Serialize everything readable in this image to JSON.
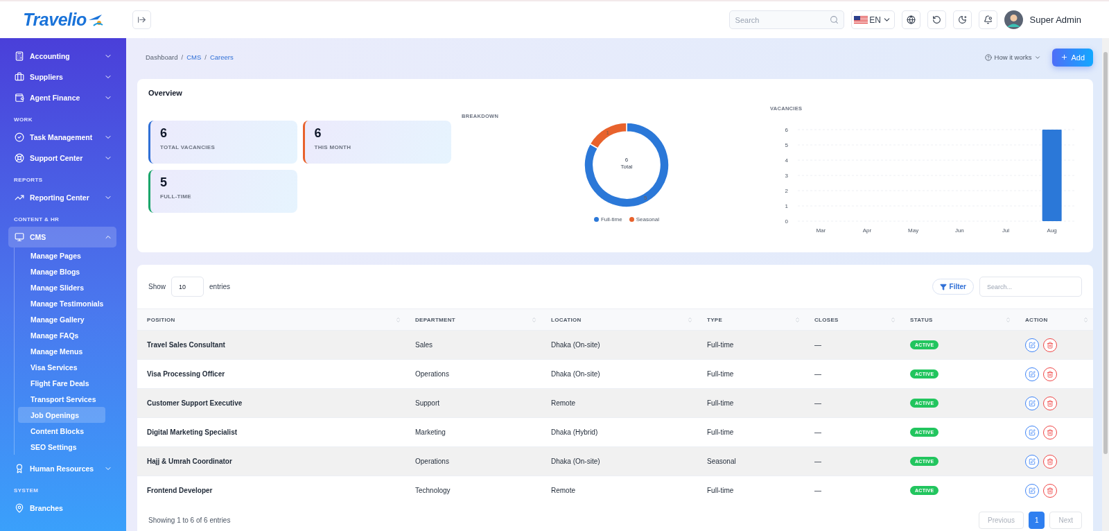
{
  "brand": {
    "name": "Travelio"
  },
  "header": {
    "search": {
      "placeholder": "Search"
    },
    "language": "EN",
    "user": "Super Admin"
  },
  "sidebar": {
    "sections": [
      {
        "items": [
          {
            "label": "Accounting",
            "expanded": false
          },
          {
            "label": "Suppliers",
            "expanded": false
          },
          {
            "label": "Agent Finance",
            "expanded": false
          }
        ]
      },
      {
        "title": "WORK",
        "items": [
          {
            "label": "Task Management",
            "expanded": false
          },
          {
            "label": "Support Center",
            "expanded": false
          }
        ]
      },
      {
        "title": "REPORTS",
        "items": [
          {
            "label": "Reporting Center",
            "expanded": false
          }
        ]
      },
      {
        "title": "CONTENT & HR",
        "items": [
          {
            "label": "CMS",
            "expanded": true,
            "children": [
              {
                "label": "Manage Pages",
                "selected": false
              },
              {
                "label": "Manage Blogs",
                "selected": false
              },
              {
                "label": "Manage Sliders",
                "selected": false
              },
              {
                "label": "Manage Testimonials",
                "selected": false
              },
              {
                "label": "Manage Gallery",
                "selected": false
              },
              {
                "label": "Manage FAQs",
                "selected": false
              },
              {
                "label": "Manage Menus",
                "selected": false
              },
              {
                "label": "Visa Services",
                "selected": false
              },
              {
                "label": "Flight Fare Deals",
                "selected": false
              },
              {
                "label": "Transport Services",
                "selected": false
              },
              {
                "label": "Job Openings",
                "selected": true
              },
              {
                "label": "Content Blocks",
                "selected": false
              },
              {
                "label": "SEO Settings",
                "selected": false
              }
            ]
          },
          {
            "label": "Human Resources",
            "expanded": false
          }
        ]
      },
      {
        "title": "SYSTEM",
        "items": [
          {
            "label": "Branches"
          }
        ]
      }
    ]
  },
  "breadcrumbs": {
    "separator": "/",
    "items": [
      {
        "label": "Dashboard",
        "link": false
      },
      {
        "label": "CMS",
        "link": true
      },
      {
        "label": "Careers",
        "link": true
      }
    ]
  },
  "page_actions": {
    "help": "How it works",
    "add": "Add"
  },
  "overview": {
    "title": "Overview",
    "stats": [
      {
        "value": "6",
        "label": "TOTAL VACANCIES",
        "color": "#2f6fd6"
      },
      {
        "value": "6",
        "label": "THIS MONTH",
        "color": "#e8622c"
      },
      {
        "value": "5",
        "label": "FULL-TIME",
        "color": "#1aa56a"
      }
    ],
    "breakdown": {
      "title": "BREAKDOWN",
      "center_value": "6",
      "center_label": "Total",
      "chart_data": {
        "type": "donut",
        "categories": [
          "Full-time",
          "Seasonal"
        ],
        "values": [
          5,
          1
        ],
        "colors": [
          "#2b78d8",
          "#e8622c"
        ],
        "data_labels": true
      }
    },
    "vacancies": {
      "title": "VACANCIES",
      "chart_data": {
        "type": "bar",
        "categories": [
          "Mar",
          "Apr",
          "May",
          "Jun",
          "Jul",
          "Aug"
        ],
        "series": [
          {
            "color": "#2b78d8",
            "values": [
              0,
              0,
              0,
              0,
              0,
              6
            ]
          }
        ],
        "grid": true,
        "ylim": [
          0,
          6
        ],
        "yticks": [
          0,
          1,
          2,
          3,
          4,
          5,
          6
        ]
      }
    }
  },
  "table": {
    "show_label": "Show",
    "page_size": "10",
    "entries_label": "entries",
    "filter": "Filter",
    "search": {
      "placeholder": "Search..."
    },
    "columns": [
      "POSITION",
      "DEPARTMENT",
      "LOCATION",
      "TYPE",
      "CLOSES",
      "STATUS",
      "ACTION"
    ],
    "rows": [
      {
        "position": "Travel Sales Consultant",
        "department": "Sales",
        "location": "Dhaka (On-site)",
        "type": "Full-time",
        "closes": "—",
        "status": "ACTIVE"
      },
      {
        "position": "Visa Processing Officer",
        "department": "Operations",
        "location": "Dhaka (On-site)",
        "type": "Full-time",
        "closes": "—",
        "status": "ACTIVE"
      },
      {
        "position": "Customer Support Executive",
        "department": "Support",
        "location": "Remote",
        "type": "Full-time",
        "closes": "—",
        "status": "ACTIVE"
      },
      {
        "position": "Digital Marketing Specialist",
        "department": "Marketing",
        "location": "Dhaka (Hybrid)",
        "type": "Full-time",
        "closes": "—",
        "status": "ACTIVE"
      },
      {
        "position": "Hajj & Umrah Coordinator",
        "department": "Operations",
        "location": "Dhaka (On-site)",
        "type": "Seasonal",
        "closes": "—",
        "status": "ACTIVE"
      },
      {
        "position": "Frontend Developer",
        "department": "Technology",
        "location": "Remote",
        "type": "Full-time",
        "closes": "—",
        "status": "ACTIVE"
      }
    ],
    "footer": "Showing 1 to 6 of 6 entries",
    "pagination": [
      {
        "label": "Previous",
        "kind": "nav",
        "disabled": true
      },
      {
        "label": "1",
        "kind": "page",
        "selected": true
      },
      {
        "label": "Next",
        "kind": "nav",
        "disabled": true
      }
    ]
  }
}
